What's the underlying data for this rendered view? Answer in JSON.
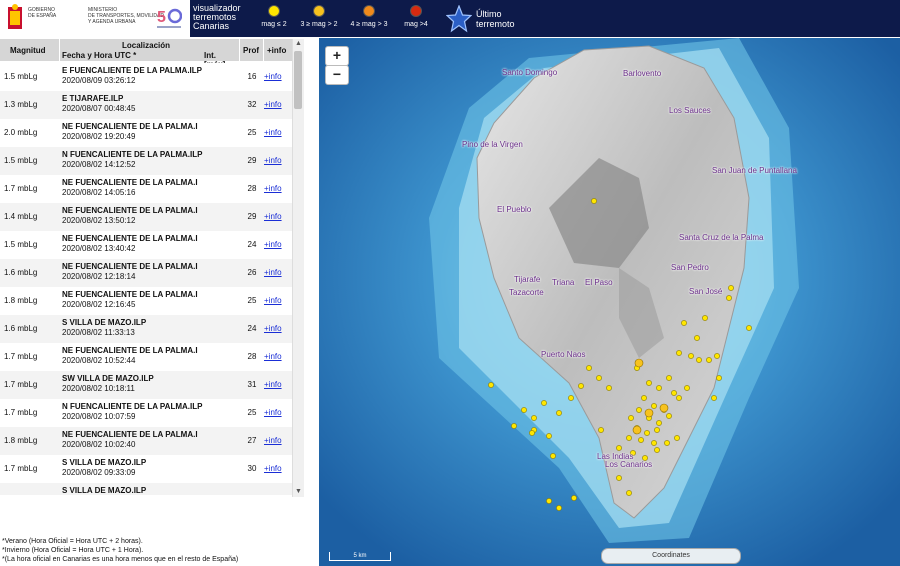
{
  "header": {
    "gov_lines": [
      "GOBIERNO",
      "DE ESPAÑA"
    ],
    "ministry_lines": [
      "MINISTERIO",
      "DE TRANSPORTES, MOVILIDAD",
      "Y AGENDA URBANA"
    ],
    "title_lines": [
      "visualizador",
      "terremotos",
      "Canarias"
    ],
    "legend": [
      {
        "label": "mag ≤ 2",
        "color": "#ffe600"
      },
      {
        "label": "3 ≥ mag > 2",
        "color": "#f7c21e"
      },
      {
        "label": "4 ≥ mag > 3",
        "color": "#f08a1c"
      },
      {
        "label": "mag >4",
        "color": "#d62a10"
      }
    ],
    "last_quake_lines": [
      "Último",
      "terremoto"
    ]
  },
  "table": {
    "headers": {
      "magnitude": "Magnitud",
      "location": "Localización",
      "datetime": "Fecha y Hora UTC *",
      "intensity": "Int. [máx]",
      "depth": "Prof",
      "info": "+info"
    },
    "rows": [
      {
        "mag": "1.5 mbLg",
        "place": "E FUENCALIENTE DE LA PALMA.ILP",
        "datetime": "2020/08/09 03:26:12",
        "depth": "16",
        "info": "+info"
      },
      {
        "mag": "1.3 mbLg",
        "place": "E TIJARAFE.ILP",
        "datetime": "2020/08/07 00:48:45",
        "depth": "32",
        "info": "+info"
      },
      {
        "mag": "2.0 mbLg",
        "place": "NE FUENCALIENTE DE LA PALMA.I",
        "datetime": "2020/08/02 19:20:49",
        "depth": "25",
        "info": "+info"
      },
      {
        "mag": "1.5 mbLg",
        "place": "N FUENCALIENTE DE LA PALMA.ILP",
        "datetime": "2020/08/02 14:12:52",
        "depth": "29",
        "info": "+info"
      },
      {
        "mag": "1.7 mbLg",
        "place": "NE FUENCALIENTE DE LA PALMA.I",
        "datetime": "2020/08/02 14:05:16",
        "depth": "28",
        "info": "+info"
      },
      {
        "mag": "1.4 mbLg",
        "place": "NE FUENCALIENTE DE LA PALMA.I",
        "datetime": "2020/08/02 13:50:12",
        "depth": "29",
        "info": "+info"
      },
      {
        "mag": "1.5 mbLg",
        "place": "NE FUENCALIENTE DE LA PALMA.I",
        "datetime": "2020/08/02 13:40:42",
        "depth": "24",
        "info": "+info"
      },
      {
        "mag": "1.6 mbLg",
        "place": "NE FUENCALIENTE DE LA PALMA.I",
        "datetime": "2020/08/02 12:18:14",
        "depth": "26",
        "info": "+info"
      },
      {
        "mag": "1.8 mbLg",
        "place": "NE FUENCALIENTE DE LA PALMA.I",
        "datetime": "2020/08/02 12:16:45",
        "depth": "25",
        "info": "+info"
      },
      {
        "mag": "1.6 mbLg",
        "place": "S VILLA DE MAZO.ILP",
        "datetime": "2020/08/02 11:33:13",
        "depth": "24",
        "info": "+info"
      },
      {
        "mag": "1.7 mbLg",
        "place": "NE FUENCALIENTE DE LA PALMA.I",
        "datetime": "2020/08/02 10:52:44",
        "depth": "28",
        "info": "+info"
      },
      {
        "mag": "1.7 mbLg",
        "place": "SW VILLA DE MAZO.ILP",
        "datetime": "2020/08/02 10:18:11",
        "depth": "31",
        "info": "+info"
      },
      {
        "mag": "1.7 mbLg",
        "place": "N FUENCALIENTE DE LA PALMA.ILP",
        "datetime": "2020/08/02 10:07:59",
        "depth": "25",
        "info": "+info"
      },
      {
        "mag": "1.8 mbLg",
        "place": "NE FUENCALIENTE DE LA PALMA.I",
        "datetime": "2020/08/02 10:02:40",
        "depth": "27",
        "info": "+info"
      },
      {
        "mag": "1.7 mbLg",
        "place": "S VILLA DE MAZO.ILP",
        "datetime": "2020/08/02 09:33:09",
        "depth": "30",
        "info": "+info"
      },
      {
        "mag": "",
        "place": "S VILLA DE MAZO.ILP",
        "datetime": "",
        "depth": "",
        "info": ""
      }
    ]
  },
  "notes": [
    "*Verano (Hora Oficial = Hora UTC + 2 horas).",
    "*Invierno (Hora Oficial = Hora UTC + 1 Hora).",
    "*(La hora oficial en Canarias es una hora menos que en el resto de España)"
  ],
  "map": {
    "zoom_in": "+",
    "zoom_out": "−",
    "places": [
      "Santo Domingo",
      "Barlovento",
      "Los Sauces",
      "Pino de la Virgen",
      "San Juan de Puntallana",
      "El Pueblo",
      "Santa Cruz de la Palma",
      "San Pedro",
      "Tijarafe",
      "Tazacorte",
      "Triana",
      "El Paso",
      "San José",
      "Puerto Naos",
      "Las Indias",
      "Los Canarios"
    ],
    "scale_label": "5 km",
    "coordinates_label": "Coordinates"
  }
}
